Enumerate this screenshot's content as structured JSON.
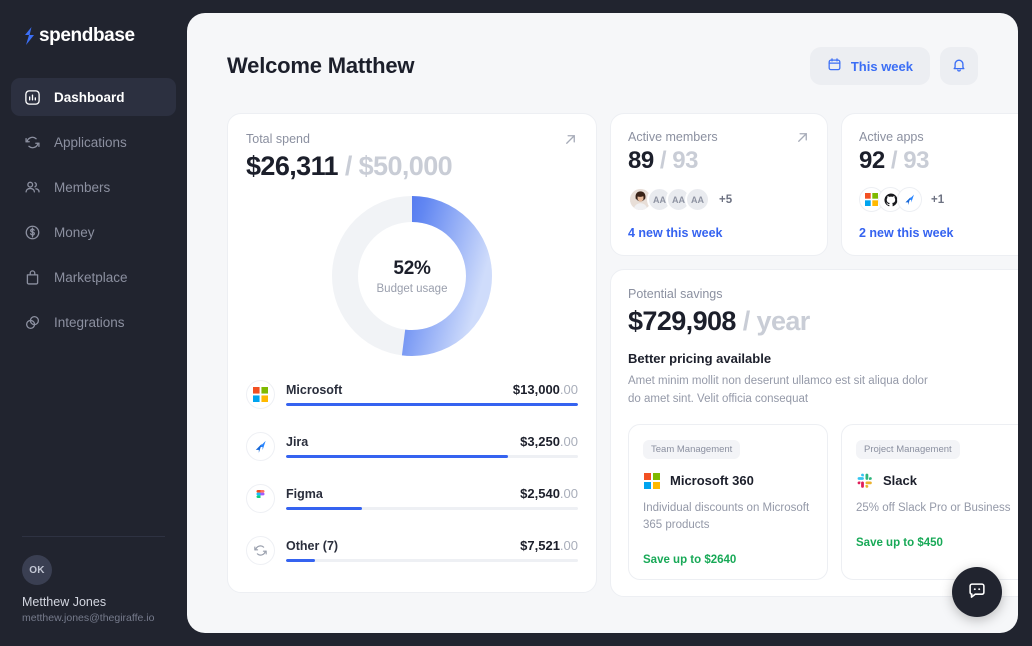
{
  "brand": {
    "name": "spendbase",
    "logo_icon": "spendbase-logo-icon"
  },
  "sidebar": {
    "items": [
      {
        "label": "Dashboard",
        "icon": "chart-bars-icon",
        "active": true
      },
      {
        "label": "Applications",
        "icon": "sync-arrows-icon",
        "active": false
      },
      {
        "label": "Members",
        "icon": "people-icon",
        "active": false
      },
      {
        "label": "Money",
        "icon": "dollar-circle-icon",
        "active": false
      },
      {
        "label": "Marketplace",
        "icon": "bag-icon",
        "active": false
      },
      {
        "label": "Integrations",
        "icon": "overlap-circles-icon",
        "active": false
      }
    ],
    "user": {
      "initials": "OK",
      "name": "Metthew Jones",
      "email": "metthew.jones@thegiraffe.io"
    }
  },
  "header": {
    "title": "Welcome Matthew",
    "week_button": {
      "label": "This week",
      "icon": "calendar-icon"
    },
    "bell_button": {
      "icon": "bell-icon"
    }
  },
  "total_spend": {
    "label": "Total spend",
    "expand_icon": "arrow-up-right-icon",
    "amount": "$26,311",
    "separator": " / ",
    "budget": "$50,000",
    "donut": {
      "percent_label": "52%",
      "caption": "Budget usage",
      "percent": 52
    },
    "apps": [
      {
        "name": "Microsoft",
        "icon": "microsoft-icon",
        "amount_main": "$13,000",
        "amount_cents": ".00",
        "bar_percent": 100
      },
      {
        "name": "Jira",
        "icon": "jira-icon",
        "amount_main": "$3,250",
        "amount_cents": ".00",
        "bar_percent": 76
      },
      {
        "name": "Figma",
        "icon": "figma-icon",
        "amount_main": "$2,540",
        "amount_cents": ".00",
        "bar_percent": 26
      },
      {
        "name": "Other (7)",
        "icon": "sync-arrows-icon",
        "amount_main": "$7,521",
        "amount_cents": ".00",
        "bar_percent": 10
      }
    ]
  },
  "active_members": {
    "label": "Active members",
    "expand_icon": "arrow-up-right-icon",
    "value": "89",
    "separator": " / ",
    "total": "93",
    "avatars": [
      {
        "type": "photo",
        "initials": ""
      },
      {
        "type": "initials",
        "initials": "AA"
      },
      {
        "type": "initials",
        "initials": "AA"
      },
      {
        "type": "initials",
        "initials": "AA"
      }
    ],
    "more": "+5",
    "footer_link": "4 new this week"
  },
  "active_apps": {
    "label": "Active apps",
    "expand_icon": "arrow-up-right-icon",
    "value": "92",
    "separator": " / ",
    "total": "93",
    "icons": [
      {
        "name": "microsoft-icon"
      },
      {
        "name": "github-icon"
      },
      {
        "name": "jira-icon"
      }
    ],
    "more": "+1",
    "footer_link": "2 new this week"
  },
  "potential_savings": {
    "label": "Potential savings",
    "expand_icon": "arrow-up-right-icon",
    "amount": "$729,908",
    "separator": " / ",
    "period": "year",
    "subtitle": "Better pricing available",
    "description": "Amet minim mollit non deserunt ullamco est sit aliqua dolor do amet sint. Velit officia consequat",
    "offers": [
      {
        "tag": "Team Management",
        "icon": "microsoft-icon",
        "name": "Microsoft 360",
        "description": "Individual discounts on Microsoft 365 products",
        "save": "Save up to $2640"
      },
      {
        "tag": "Project Management",
        "icon": "slack-icon",
        "name": "Slack",
        "description": "25% off Slack Pro or Business",
        "save": "Save up to $450"
      }
    ]
  },
  "chat_fab": {
    "icon": "chat-bubble-icon"
  },
  "colors": {
    "sidebar_bg": "#21242f",
    "panel_bg": "#f6f7f9",
    "card_bg": "#ffffff",
    "accent_blue": "#3563f0",
    "link_blue": "#3b6ef5",
    "success_green": "#18a957",
    "muted_gray": "#c9cdd6",
    "text_dark": "#1c1f2b"
  }
}
